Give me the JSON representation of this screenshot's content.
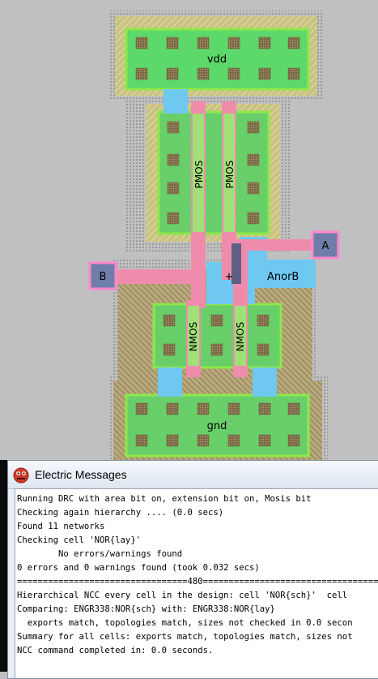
{
  "layout_view": {
    "labels": {
      "vdd": "vdd",
      "gnd": "gnd",
      "pmos": "PMOS",
      "nmos": "NMOS",
      "output": "AnorB",
      "cross": "+"
    },
    "pins": {
      "a": "A",
      "b": "B"
    },
    "colors": {
      "background": "#c0c0c0",
      "metal1": "#6fc8f0",
      "poly": "#f08cab",
      "active": "#5dd86b",
      "contact": "#8a7a4a",
      "well": "#e6e08a",
      "select": "#c8a080",
      "pin_fill": "#6f7ea8",
      "pin_border": "#ff88cc"
    }
  },
  "messages_window": {
    "title": "Electric Messages",
    "icon": "electric-app-icon",
    "lines": [
      "Running DRC with area bit on, extension bit on, Mosis bit",
      "Checking again hierarchy .... (0.0 secs)",
      "Found 11 networks",
      "Checking cell 'NOR{lay}'",
      "        No errors/warnings found",
      "0 errors and 0 warnings found (took 0.032 secs)",
      "=================================480==================================",
      "Hierarchical NCC every cell in the design: cell 'NOR{sch}'  cell",
      "Comparing: ENGR338:NOR{sch} with: ENGR338:NOR{lay}",
      "  exports match, topologies match, sizes not checked in 0.0 secon",
      "Summary for all cells: exports match, topologies match, sizes not",
      "NCC command completed in: 0.0 seconds."
    ]
  }
}
